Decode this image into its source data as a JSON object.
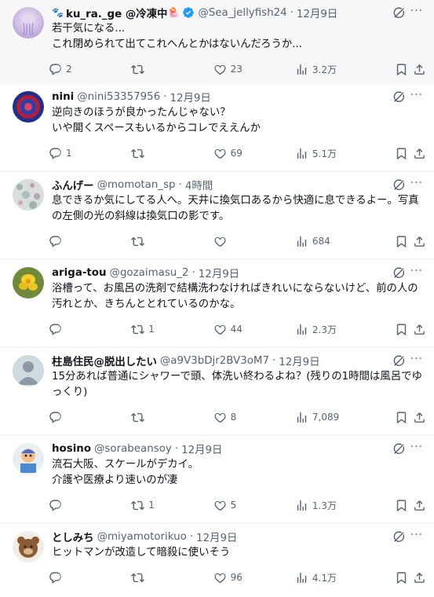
{
  "tweets": [
    {
      "name": "ku_ra._ge @冷凍中",
      "name_prefix_emoji": "🐾",
      "name_suffix_emoji": "🪼",
      "verified": true,
      "handle": "@Sea_jellyfish24",
      "time": "12月9日",
      "text": "若干気になる...\nこれ閉められて出てこれへんとかはないんだろうか...",
      "replies": "2",
      "retweets": "",
      "likes": "23",
      "views": "3.2万",
      "highlighted": true
    },
    {
      "name": "nini",
      "handle": "@nini53357956",
      "time": "12月9日",
      "text": "逆向きのほうが良かったんじゃない？\nいや開くスペースもいるからコレでええんか",
      "replies": "1",
      "retweets": "",
      "likes": "69",
      "views": "5.1万"
    },
    {
      "name": "ふんげー",
      "handle": "@momotan_sp",
      "time": "4時間",
      "text": "息できるか気にしてる人へ。天井に換気口あるから快適に息できるよー。写真の左側の光の斜線は換気口の影です。",
      "replies": "",
      "retweets": "",
      "likes": "",
      "views": "684"
    },
    {
      "name": "ariga-tou",
      "handle": "@gozaimasu_2",
      "time": "12月9日",
      "text": "浴槽って、お風呂の洗剤で結構洗わなければきれいにならないけど、前の人の汚れとか、きちんととれているのかな。",
      "replies": "",
      "retweets": "1",
      "likes": "44",
      "views": "2.3万"
    },
    {
      "name": "柱島住民@脱出したい",
      "handle": "@a9V3bDjr2BV3oM7",
      "time": "12月9日",
      "text": "15分あれば普通にシャワーで頭、体洗い終わるよね？(残りの1時間は風呂でゆっくり)",
      "replies": "",
      "retweets": "",
      "likes": "8",
      "views": "7,089"
    },
    {
      "name": "hosino",
      "handle": "@sorabeansoy",
      "time": "12月9日",
      "text": "流石大阪、スケールがデカイ。\n介護や医療より速いのが凄",
      "replies": "",
      "retweets": "1",
      "likes": "5",
      "views": "1.3万"
    },
    {
      "name": "としみち",
      "handle": "@miyamotorikuo",
      "time": "12月9日",
      "text": "ヒットマンが改造して暗殺に使いそう",
      "replies": "",
      "retweets": "",
      "likes": "96",
      "views": "4.1万"
    }
  ],
  "colors": {
    "text": "#0f1419",
    "secondary": "#536471",
    "verified": "#1d9bf0",
    "divider": "#eff3f4",
    "highlight_bg": "#f7f7f7"
  },
  "more_icon_glyph": "···"
}
